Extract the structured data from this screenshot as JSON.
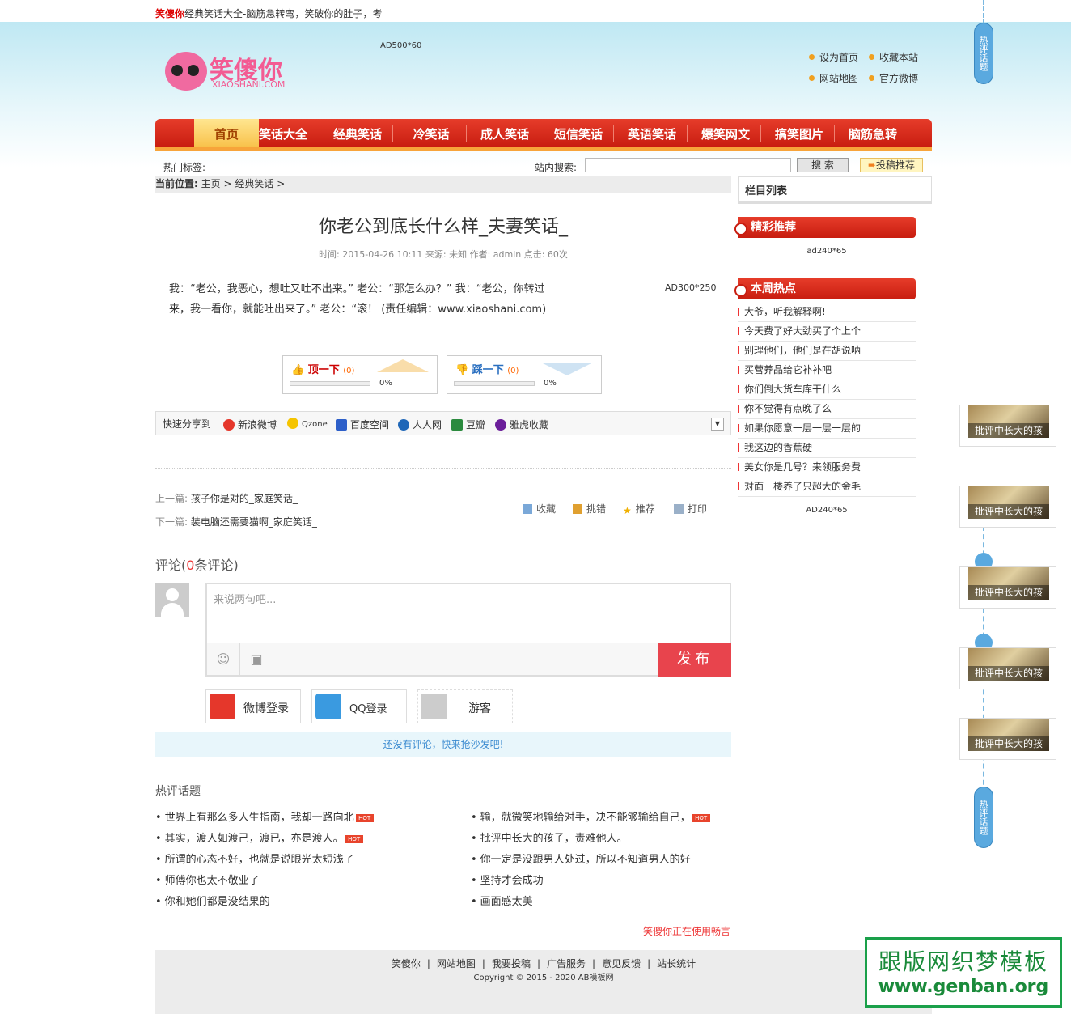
{
  "topbar": {
    "brand": "笑傻你",
    "slogan": "经典笑话大全-脑筋急转弯，笑破你的肚子，考"
  },
  "logo": {
    "text": "笑傻你",
    "url_text": "XIAOSHANI.COM"
  },
  "header": {
    "ad_text": "AD500*60",
    "links": [
      "设为首页",
      "收藏本站",
      "网站地图",
      "官方微博"
    ]
  },
  "nav": {
    "items": [
      "首页",
      "笑话大全",
      "经典笑话",
      "冷笑话",
      "成人笑话",
      "短信笑话",
      "英语笑话",
      "爆笑网文",
      "搞笑图片",
      "脑筋急转"
    ]
  },
  "toolbar": {
    "hot_tags_label": "热门标签:",
    "search_label": "站内搜索:",
    "search_button": "搜 索",
    "submit_label": "投稿推荐"
  },
  "breadcrumb": {
    "label": "当前位置:",
    "items": [
      "主页",
      "经典笑话"
    ],
    "sep": ">"
  },
  "article": {
    "title": "你老公到底长什么样_夫妻笑话_",
    "meta": "时间: 2015-04-26 10:11  来源: 未知   作者: admin   点击: 60次",
    "body_line1": "我：“老公，我恶心，想吐又吐不出来。”      老公：“那怎么办？”      我：“老公，你转过",
    "body_line2": "来，我一看你，就能吐出来了。”       老公：“滚！ (责任编辑：www.xiaoshani.com)",
    "ad_text": "AD300*250"
  },
  "vote": {
    "up_label": "顶一下",
    "up_count": "(0)",
    "up_pct": "0%",
    "up_fraction": 0,
    "down_label": "踩一下",
    "down_count": "(0)",
    "down_pct": "0%",
    "down_fraction": 0
  },
  "share": {
    "label": "快速分享到",
    "items": [
      "新浪微博",
      "Qzone",
      "百度空间",
      "人人网",
      "豆瓣",
      "雅虎收藏"
    ],
    "dropdown": "▼"
  },
  "prevnext": {
    "prev_label": "上一篇:",
    "prev_title": "孩子你是对的_家庭笑话_",
    "next_label": "下一篇:",
    "next_title": "装电脑还需要猫啊_家庭笑话_"
  },
  "tools": [
    "收藏",
    "挑错",
    "推荐",
    "打印"
  ],
  "comments": {
    "head_prefix": "评论(",
    "count": "0",
    "head_suffix": "条评论)",
    "placeholder": "来说两句吧...",
    "emoji_icon": "☺",
    "image_icon": "▣",
    "publish": "发布",
    "logins": [
      "微博登录",
      "QQ登录",
      "游客"
    ],
    "empty_text": "还没有评论，快来抢沙发吧!"
  },
  "hot_topics": {
    "title": "热评话题",
    "badge": "HOT",
    "left": [
      "世界上有那么多人生指南，我却一路向北",
      "其实，渡人如渡己，渡已，亦是渡人。",
      "所谓的心态不好，也就是说眼光太短浅了",
      "师傅你也太不敬业了",
      "你和她们都是没结果的"
    ],
    "right": [
      "输，就微笑地输给对手，决不能够输给自己，",
      "批评中长大的孩子，责难他人。",
      "你一定是没跟男人处过，所以不知道男人的好",
      "坚持才会成功",
      "画面感太美"
    ]
  },
  "using_text": "笑傻你正在使用畅言",
  "footer": {
    "links": [
      "笑傻你",
      "|",
      "网站地图",
      "|",
      "我要投稿",
      "|",
      "广告服务",
      "|",
      "意见反馈",
      "|",
      "站长统计"
    ],
    "copyright": "Copyright © 2015 - 2020 AB模板网"
  },
  "sidebar": {
    "column_list_title": "栏目列表",
    "featured_title": "精彩推荐",
    "ad1": "ad240*65",
    "week_title": "本周热点",
    "week_items": [
      "大爷，听我解释啊!",
      "今天费了好大劲买了个上个",
      "别理他们，他们是在胡说呐",
      "买营养品给它补补吧",
      "你们倒大货车库干什么",
      "你不觉得有点晚了么",
      "如果你愿意一层一层一层的",
      "我这边的香蕉硬",
      "美女你是几号？来领服务费",
      "对面一楼养了只超大的金毛"
    ],
    "ad2": "AD240*65"
  },
  "right_float": {
    "tab_label": "热评话题",
    "card_caption": "批评中长大的孩"
  },
  "watermark": {
    "line1": "跟版网织梦模板",
    "line2": "www.genban.org"
  },
  "colors": {
    "nav_red": "#d4281a",
    "accent_orange": "#f7a43a",
    "publish_red": "#e8444d",
    "watermark_green": "#1aa04a"
  }
}
